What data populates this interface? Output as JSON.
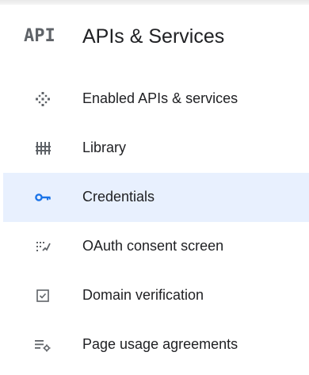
{
  "header": {
    "logo_text": "API",
    "title": "APIs & Services"
  },
  "colors": {
    "active_bg": "#e8f0fe",
    "active_icon": "#1a73e8",
    "icon_gray": "#5f6368",
    "text": "#202124"
  },
  "nav": {
    "items": [
      {
        "label": "Enabled APIs & services",
        "icon": "diamond-dots-icon",
        "active": false
      },
      {
        "label": "Library",
        "icon": "library-icon",
        "active": false
      },
      {
        "label": "Credentials",
        "icon": "key-icon",
        "active": true
      },
      {
        "label": "OAuth consent screen",
        "icon": "consent-icon",
        "active": false
      },
      {
        "label": "Domain verification",
        "icon": "checkbox-icon",
        "active": false
      },
      {
        "label": "Page usage agreements",
        "icon": "settings-list-icon",
        "active": false
      }
    ]
  }
}
